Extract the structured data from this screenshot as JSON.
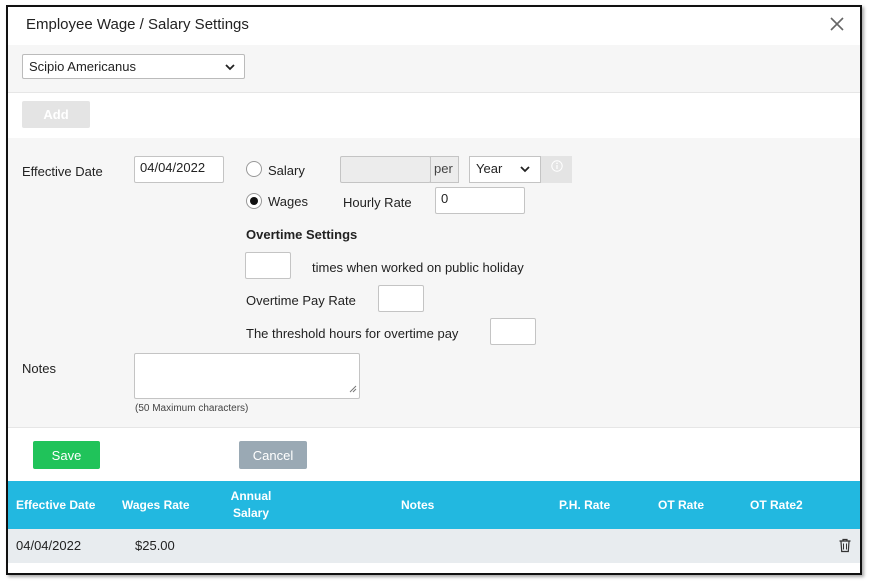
{
  "dialog": {
    "title": "Employee Wage / Salary Settings"
  },
  "employee": {
    "selected": "Scipio Americanus"
  },
  "toolbar": {
    "add_label": "Add"
  },
  "form": {
    "effective_date_label": "Effective Date",
    "effective_date_value": "04/04/2022",
    "salary_label": "Salary",
    "salary_value": "",
    "per_label": "per",
    "period_selected": "Year",
    "wages_label": "Wages",
    "hourly_rate_label": "Hourly Rate",
    "hourly_rate_value": "0",
    "pay_type_selected": "Wages",
    "overtime_heading": "Overtime Settings",
    "public_holiday_label": "times when worked on public holiday",
    "public_holiday_value": "",
    "overtime_pay_rate_label": "Overtime Pay Rate",
    "overtime_pay_rate_value": "",
    "threshold_label": "The threshold hours for overtime pay",
    "threshold_value": "",
    "notes_label": "Notes",
    "notes_value": "",
    "notes_hint": "(50 Maximum characters)"
  },
  "actions": {
    "save_label": "Save",
    "cancel_label": "Cancel"
  },
  "table": {
    "columns": [
      "Effective Date",
      "Wages Rate",
      "Annual Salary",
      "Notes",
      "P.H. Rate",
      "OT Rate",
      "OT Rate2"
    ],
    "rows": [
      [
        "04/04/2022",
        "$25.00",
        "",
        "",
        "",
        "",
        ""
      ]
    ]
  },
  "colors": {
    "header_blue": "#22b8e0",
    "save_green": "#20c35a",
    "cancel_gray": "#9aa9b4"
  },
  "icons": [
    "close-icon",
    "chevron-down-icon",
    "info-icon",
    "trash-icon"
  ]
}
